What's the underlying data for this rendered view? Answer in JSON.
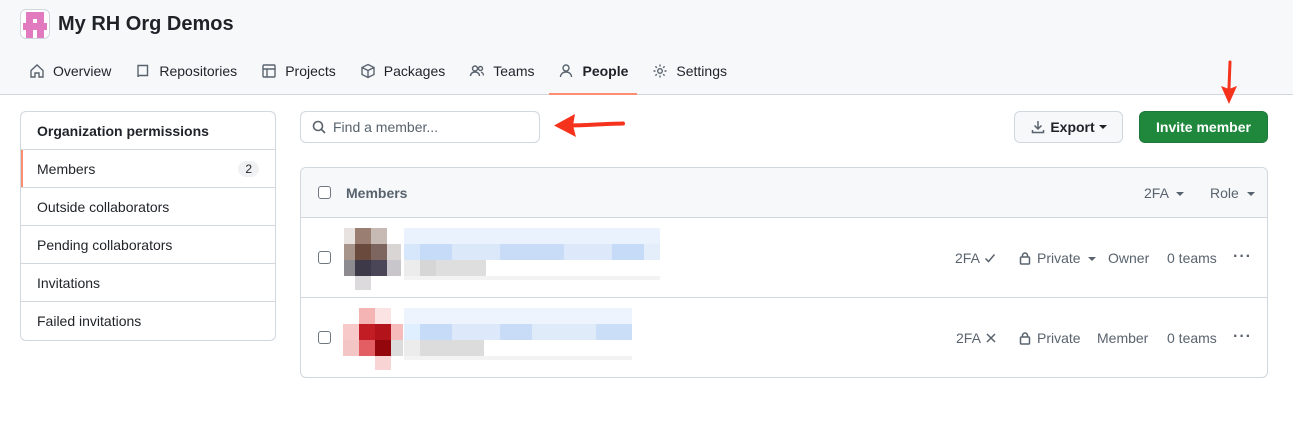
{
  "org": {
    "name": "My RH Org Demos"
  },
  "nav": [
    {
      "label": "Overview",
      "icon": "home-icon"
    },
    {
      "label": "Repositories",
      "icon": "repo-icon"
    },
    {
      "label": "Projects",
      "icon": "table-icon"
    },
    {
      "label": "Packages",
      "icon": "package-icon"
    },
    {
      "label": "Teams",
      "icon": "people-icon"
    },
    {
      "label": "People",
      "icon": "person-icon",
      "active": true
    },
    {
      "label": "Settings",
      "icon": "gear-icon"
    }
  ],
  "sidebar": {
    "heading": "Organization permissions",
    "items": [
      {
        "label": "Members",
        "count": "2",
        "active": true
      },
      {
        "label": "Outside collaborators"
      },
      {
        "label": "Pending collaborators"
      },
      {
        "label": "Invitations"
      },
      {
        "label": "Failed invitations"
      }
    ]
  },
  "search": {
    "placeholder": "Find a member..."
  },
  "toolbar": {
    "export_label": "Export",
    "invite_label": "Invite member"
  },
  "table": {
    "header": {
      "title": "Members",
      "twofa_filter": "2FA",
      "role_filter": "Role"
    },
    "rows": [
      {
        "twofa": "2FA",
        "twofa_status": "enabled",
        "visibility": "Private",
        "role": "Owner",
        "teams": "0 teams"
      },
      {
        "twofa": "2FA",
        "twofa_status": "disabled",
        "visibility": "Private",
        "role": "Member",
        "teams": "0 teams"
      }
    ]
  },
  "colors": {
    "accent_underline": "#fd8c73",
    "primary_button": "#1f883d",
    "annotation_arrow": "#f5331c"
  }
}
